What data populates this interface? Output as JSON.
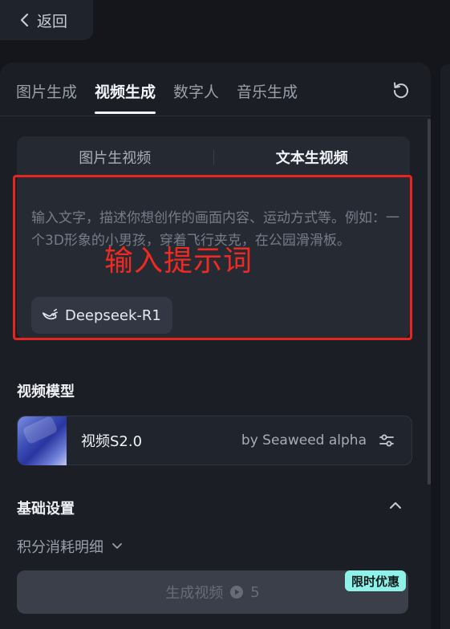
{
  "back": {
    "label": "返回"
  },
  "tabs": [
    {
      "label": "图片生成"
    },
    {
      "label": "视频生成"
    },
    {
      "label": "数字人"
    },
    {
      "label": "音乐生成"
    }
  ],
  "mode_switch": {
    "image_to_video": "图片生视频",
    "text_to_video": "文本生视频"
  },
  "prompt": {
    "placeholder": "输入文字，描述你想创作的画面内容、运动方式等。例如：一个3D形象的小男孩，穿着飞行夹克，在公园滑滑板。",
    "model_chip": "Deepseek-R1"
  },
  "annotation": {
    "label": "输入提示词",
    "color": "#e8241e"
  },
  "video_model": {
    "section_title": "视频模型",
    "name": "视频S2.0",
    "by": "by Seaweed alpha"
  },
  "basic_settings": {
    "section_title": "基础设置"
  },
  "cost": {
    "label": "积分消耗明细"
  },
  "generate": {
    "label": "生成视频",
    "cost": "5",
    "badge": "限时优惠",
    "badge_color": "#8ef2e8"
  },
  "icons": {
    "back": "chevron-left-icon",
    "refresh": "refresh-icon",
    "deepseek": "whale-icon",
    "settings": "sliders-icon",
    "collapse": "chevron-up-icon",
    "expand": "chevron-down-icon",
    "credit": "play-circle-icon"
  }
}
